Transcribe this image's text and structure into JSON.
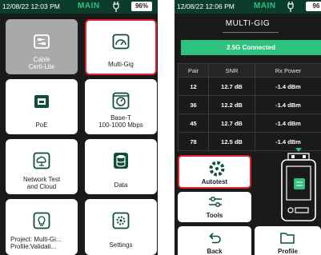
{
  "left_screen": {
    "status": {
      "time": "12/08/22 12:03 PM",
      "title": "MAIN",
      "battery": "96%"
    },
    "tiles": [
      {
        "label": "Cable\nCerti-Lite",
        "icon": "cable-icon"
      },
      {
        "label": "Multi-Gig",
        "icon": "gauge-icon"
      },
      {
        "label": "PoE",
        "icon": "ethernet-port-icon"
      },
      {
        "label": "Base-T\n100-1000 Mbps",
        "icon": "speedometer-icon"
      },
      {
        "label": "Network Test\nand Cloud",
        "icon": "cloud-network-icon"
      },
      {
        "label": "Data",
        "icon": "database-icon"
      },
      {
        "label": "Project: Multi-Gi...\nProfile:Validati...",
        "icon": "lightbulb-icon"
      },
      {
        "label": "Settings",
        "icon": "gear-icon"
      }
    ]
  },
  "right_screen": {
    "status": {
      "time": "12/08/22 12:06 PM",
      "title": "MAIN",
      "battery": "96"
    },
    "panel_title": "MULTI-GIG",
    "connection": "2.5G Connected",
    "table": {
      "headers": [
        "Pair",
        "SNR",
        "Rx Power"
      ],
      "rows": [
        [
          "12",
          "12.7 dB",
          "-1.4 dBm"
        ],
        [
          "36",
          "12.2 dB",
          "-1.4 dBm"
        ],
        [
          "45",
          "12.7 dB",
          "-1.4 dBm"
        ],
        [
          "78",
          "12.5 dB",
          "-1.4 dBm"
        ]
      ]
    },
    "buttons": {
      "autotest": "Autotest",
      "tools": "Tools",
      "back": "Back",
      "profile": "Profile"
    }
  },
  "colors": {
    "accent_green": "#2ec27e",
    "status_bar": "#0c3d2c",
    "selection_red": "#e0262c",
    "tile_teal": "#0d4f3a"
  }
}
